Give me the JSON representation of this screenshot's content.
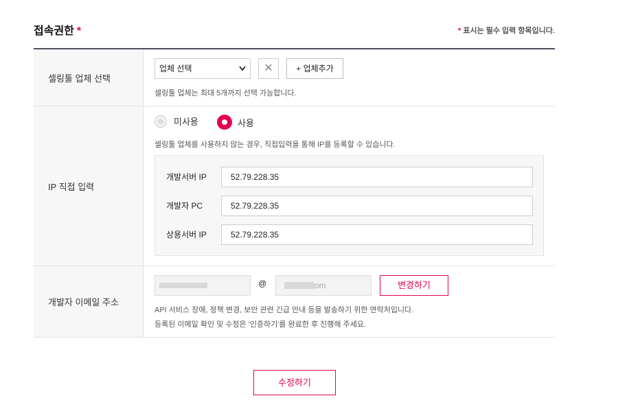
{
  "section": {
    "title": "접속권한",
    "required_mark": "*",
    "note_mark": "*",
    "note": "표시는 필수 입력 항목입니다."
  },
  "vendor": {
    "label": "셀링툴 업체 선택",
    "select_value": "업체 선택",
    "remove_symbol": "✕",
    "add_button": "+ 업체추가",
    "help": "셀링툴 업체는 최대 5개까지 선택 가능합니다."
  },
  "ip": {
    "label": "IP 직접 입력",
    "radio_off": "미사용",
    "radio_on": "사용",
    "selected": "사용",
    "help": "셀링툴 업체를 사용하지 않는 경우, 직접입력을 통해 IP를 등록할 수 있습니다.",
    "fields": [
      {
        "label": "개발서버 IP",
        "value": "52.79.228.35"
      },
      {
        "label": "개발자 PC",
        "value": "52.79.228.35"
      },
      {
        "label": "상용서버 IP",
        "value": "52.79.228.35"
      }
    ]
  },
  "email": {
    "label": "개발자 이메일 주소",
    "at": "@",
    "domain_visible": "om",
    "change_button": "변경하기",
    "help1": "API 서비스 장애, 정책 변경, 보안 관련 긴급 안내 등을 발송하기 위한 연락처입니다.",
    "help2": "등록된 이메일 확인 및 수정은 '인증하기'를 완료한 후 진행해 주세요."
  },
  "submit_button": "수정하기",
  "colors": {
    "accent": "#e5004f",
    "header_border": "#4a4f5a",
    "label_bg": "#f7f7f7"
  }
}
